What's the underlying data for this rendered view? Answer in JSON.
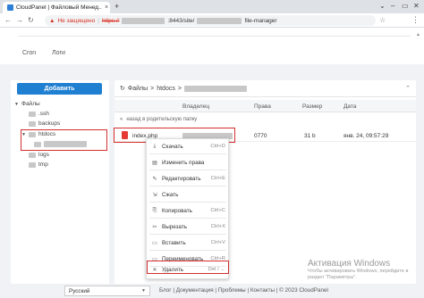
{
  "browser": {
    "tab_title": "CloudPanel | Файловый Менед...",
    "tab_close": "×",
    "new_tab": "+",
    "not_secure": "Не защищено",
    "url_prefix": "https://",
    "url_port_path": ":8443/site/",
    "url_tail": "file-manager"
  },
  "topnav": {
    "items": [
      "Cron",
      "Логи"
    ]
  },
  "sidebar": {
    "add_button": "Добавить",
    "tree": [
      {
        "label": "Файлы"
      },
      {
        "label": ".ssh"
      },
      {
        "label": "backups"
      },
      {
        "label": "htdocs"
      },
      {
        "label": ""
      },
      {
        "label": "logs"
      },
      {
        "label": "tmp"
      }
    ]
  },
  "breadcrumb": {
    "root": "Файлы",
    "sep": ">",
    "folder": "htdocs",
    "sep2": ">"
  },
  "table": {
    "headers": [
      "Владелец",
      "Права",
      "Размер",
      "Дата"
    ],
    "up_link": "назад в родительскую папку",
    "rows": [
      {
        "name": "index.php",
        "perms": "0770",
        "size": "31 b",
        "date": "янв. 24, 09:57:29"
      }
    ]
  },
  "context_menu": {
    "items": [
      {
        "icon": "download-icon",
        "glyph": "⤓",
        "label": "Скачать",
        "shortcut": "Ctrl+D"
      },
      {
        "icon": "permissions-icon",
        "glyph": "▤",
        "label": "Изменить права",
        "shortcut": ""
      },
      {
        "icon": "edit-icon",
        "glyph": "✎",
        "label": "Редактировать",
        "shortcut": "Ctrl+E"
      },
      {
        "icon": "compress-icon",
        "glyph": "⇲",
        "label": "Сжать",
        "shortcut": ""
      },
      {
        "icon": "copy-icon",
        "glyph": "⎘",
        "label": "Копировать",
        "shortcut": "Ctrl+C"
      },
      {
        "icon": "cut-icon",
        "glyph": "✂",
        "label": "Вырезать",
        "shortcut": "Ctrl+X"
      },
      {
        "icon": "paste-icon",
        "glyph": "▭",
        "label": "Вставить",
        "shortcut": "Ctrl+V"
      },
      {
        "icon": "rename-icon",
        "glyph": "▭",
        "label": "Переименовать",
        "shortcut": "Ctrl+R"
      },
      {
        "icon": "delete-icon",
        "glyph": "✕",
        "label": "Удалить",
        "shortcut": "Del / ←"
      }
    ]
  },
  "watermark": {
    "title": "Активация Windows",
    "subtitle": "Чтобы активировать Windows, перейдите в раздел \"Параметры\"."
  },
  "footer": {
    "language": "Русский",
    "links": [
      "Блог",
      "Документация",
      "Проблемы",
      "Контакты",
      "© 2023  CloudPanel"
    ]
  },
  "colors": {
    "accent": "#1f7fd1",
    "highlight": "#d32f2f",
    "file_icon": "#e53935"
  }
}
